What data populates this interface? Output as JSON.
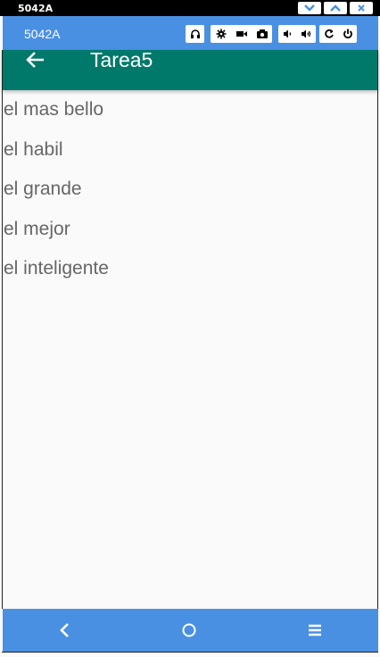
{
  "window": {
    "title": "5042A"
  },
  "emulator_toolbar": {
    "device_name": "5042A",
    "buttons": [
      "headphones-icon",
      "gear-icon",
      "video-icon",
      "camera-icon",
      "volume-down-icon",
      "volume-up-icon",
      "rotate-icon",
      "power-icon"
    ]
  },
  "appbar": {
    "title": "Tarea5",
    "color": "#00796b"
  },
  "list": {
    "items": [
      {
        "label": "el mas bello"
      },
      {
        "label": "el habil"
      },
      {
        "label": "el grande"
      },
      {
        "label": "el mejor"
      },
      {
        "label": "el inteligente"
      }
    ]
  },
  "navbar": {
    "buttons": [
      "back-icon",
      "home-icon",
      "menu-icon"
    ],
    "color": "#4a90e2"
  }
}
